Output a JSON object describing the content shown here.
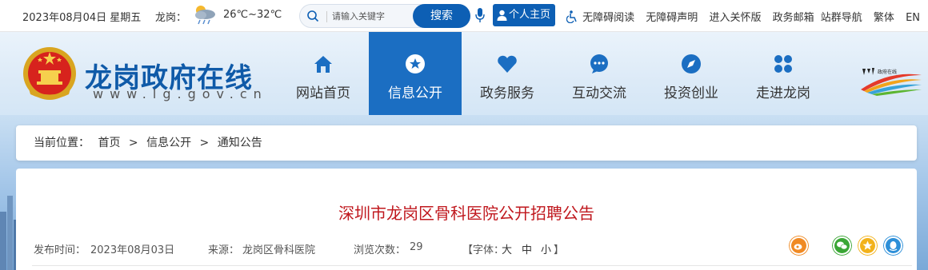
{
  "topbar": {
    "date": "2023年08月04日 星期五",
    "location_label": "龙岗：",
    "weather_icon": "cloudy-rain-icon",
    "temperature": "26℃~32℃",
    "search_placeholder": "请输入关键字",
    "search_button": "搜索",
    "user_center": "个人主页",
    "links": [
      "无障碍阅读",
      "无障碍声明",
      "进入关怀版",
      "政务邮箱",
      "站群导航",
      "繁体",
      "EN"
    ]
  },
  "header": {
    "site_title": "龙岗政府在线",
    "site_url": "www.lg.gov.cn",
    "nav": [
      {
        "label": "网站首页",
        "icon": "home-icon"
      },
      {
        "label": "信息公开",
        "icon": "star-icon"
      },
      {
        "label": "政务服务",
        "icon": "heart-icon"
      },
      {
        "label": "互动交流",
        "icon": "chat-icon"
      },
      {
        "label": "投资创业",
        "icon": "compass-icon"
      },
      {
        "label": "走进龙岗",
        "icon": "grid-icon"
      }
    ],
    "active_nav": "信息公开"
  },
  "breadcrumb": {
    "prefix": "当前位置：",
    "items": [
      "首页",
      "信息公开",
      "通知公告"
    ],
    "separator": ">"
  },
  "article": {
    "title": "深圳市龙岗区骨科医院公开招聘公告",
    "publish_label": "发布时间：",
    "publish_date": "2023年08月03日",
    "source_label": "来源：",
    "source": "龙岗区骨科医院",
    "views_label": "浏览次数：",
    "views": "29",
    "font_label": "【字体：",
    "font_sizes": [
      "大",
      "中",
      "小"
    ],
    "font_close": "】",
    "share_icons": [
      "weibo-icon",
      "wechat-icon",
      "favorite-star-icon",
      "qq-icon"
    ]
  },
  "colors": {
    "brand_blue": "#0d5fb4",
    "nav_active": "#1b6ec2",
    "title_red": "#c0181e",
    "share_orange": "#f08a24",
    "share_green": "#3aa635",
    "share_blue": "#2d8fd8"
  }
}
